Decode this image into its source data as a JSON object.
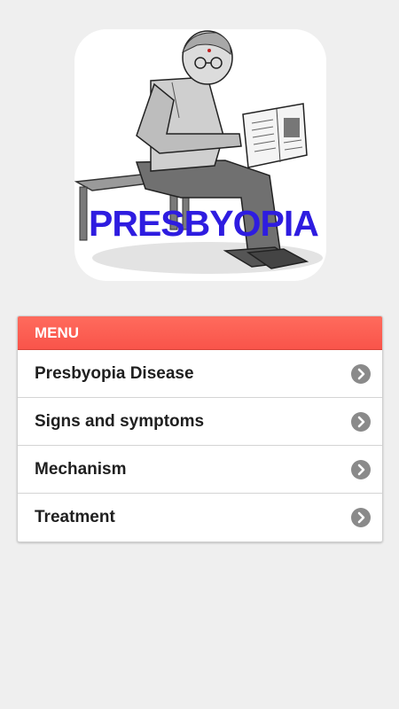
{
  "hero": {
    "title": "PRESBYOPIA"
  },
  "menu": {
    "header": "MENU",
    "items": [
      {
        "label": "Presbyopia Disease"
      },
      {
        "label": "Signs and symptoms"
      },
      {
        "label": "Mechanism"
      },
      {
        "label": "Treatment"
      }
    ]
  },
  "colors": {
    "background": "#efefef",
    "menu_header": "#f9544a",
    "hero_title": "#2e1ce0",
    "chevron": "#8a8a8a"
  },
  "icons": {
    "chevron": "chevron-right-circle-icon"
  }
}
